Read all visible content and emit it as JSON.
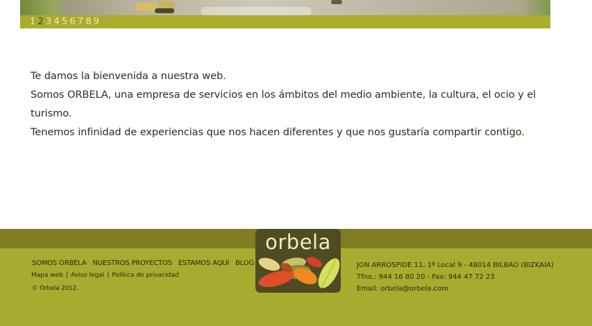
{
  "slider": {
    "numbers": [
      "1",
      "2",
      "3",
      "4",
      "5",
      "6",
      "7",
      "8",
      "9"
    ],
    "active_index": 2
  },
  "welcome": {
    "line1": "Te damos la bienvenida a nuestra web.",
    "line2": "Somos ORBELA, una empresa de servicios en los ámbitos del medio ambiente, la cultura, el ocio y el turismo.",
    "line3": "Tenemos infinidad de experiencias que nos hacen diferentes y que nos gustaría compartir contigo."
  },
  "footer": {
    "nav": [
      "SOMOS ORBELA",
      "NUESTROS PROYECTOS",
      "ESTAMOS AQUÍ",
      "BLOG"
    ],
    "links": [
      "Mapa web",
      "Aviso legal",
      "Política de privacidad"
    ],
    "link_separator": "|",
    "copyright": "© Orbela 2012.",
    "address": "JON ARROSPIDE 11, 1º Local 9 - 48014 BILBAO (BIZKAIA)",
    "phone": "Tfno.: 944 16 80 20 - Fax: 944 47 72 23",
    "email": "Email: orbela@orbela.com"
  },
  "logo": {
    "text": "orbela",
    "icon": "leaves-logo-icon"
  },
  "colors": {
    "olive_bar": "#a9ac2c",
    "footer_dark": "#7f7c22",
    "footer_main": "#a8ab2f",
    "logo_bg": "#4f4b22",
    "text": "#2d2d18"
  }
}
